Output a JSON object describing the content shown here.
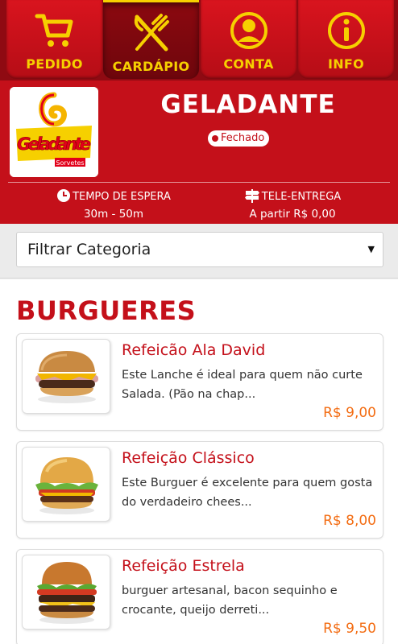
{
  "nav": {
    "tabs": [
      {
        "label": "PEDIDO",
        "icon": "cart-icon",
        "active": false
      },
      {
        "label": "CARDÁPIO",
        "icon": "fork-knife-icon",
        "active": true
      },
      {
        "label": "CONTA",
        "icon": "user-icon",
        "active": false
      },
      {
        "label": "INFO",
        "icon": "info-icon",
        "active": false
      }
    ],
    "accent": "#f6d000"
  },
  "store": {
    "name": "GELADANTE",
    "status": "Fechado",
    "logo": {
      "brand": "Geladante",
      "tagline": "Sorvetes"
    },
    "wait_label": "TEMPO DE ESPERA",
    "wait_value": "30m - 50m",
    "delivery_label": "TELE-ENTREGA",
    "delivery_value": "A partir R$ 0,00",
    "color": "#c4101a"
  },
  "filter": {
    "label": "Filtrar Categoria",
    "caret": "▼"
  },
  "section": {
    "title": "BURGUERES",
    "items": [
      {
        "title": "Refeicão Ala David",
        "desc": "Este Lanche é ideal para quem não curte Salada. (Pão na chap...",
        "price": "R$ 9,00"
      },
      {
        "title": "Refeição Clássico",
        "desc": "Este Burguer é excelente para quem gosta do verdadeiro chees...",
        "price": "R$ 8,00"
      },
      {
        "title": "Refeição Estrela",
        "desc": "burguer artesanal, bacon sequinho e crocante, queijo derreti...",
        "price": "R$ 9,50"
      }
    ]
  },
  "price_color": "#f36c12"
}
